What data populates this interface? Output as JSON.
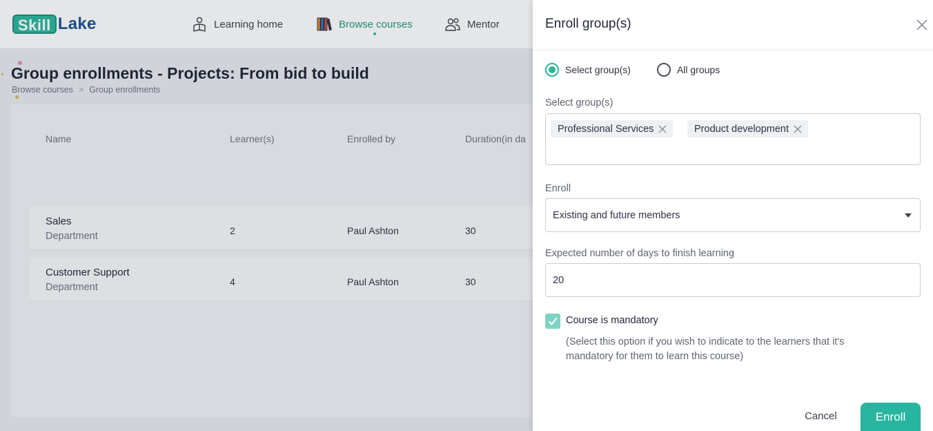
{
  "colors": {
    "accent": "#2bb59a",
    "enroll_button": "#28b5a0",
    "checkbox_checked": "#7fd3c2"
  },
  "header": {
    "logo_skill": "Skill",
    "logo_lake": "Lake",
    "nav": [
      {
        "label": "Learning home",
        "icon": "learner-icon"
      },
      {
        "label": "Browse courses",
        "icon": "books-icon",
        "active": true
      },
      {
        "label": "Mentor",
        "icon": "people-icon"
      }
    ]
  },
  "page": {
    "title": "Group enrollments - Projects: From bid to build",
    "breadcrumb": [
      "Browse courses",
      "Group enrollments"
    ],
    "breadcrumb_separator": ">",
    "table": {
      "columns": [
        "Name",
        "Learner(s)",
        "Enrolled by",
        "Duration(in da"
      ],
      "rows": [
        {
          "name": "Sales",
          "type": "Department",
          "learners": "2",
          "enrolled_by": "Paul Ashton",
          "duration": "30"
        },
        {
          "name": "Customer Support",
          "type": "Department",
          "learners": "4",
          "enrolled_by": "Paul Ashton",
          "duration": "30"
        }
      ]
    }
  },
  "panel": {
    "title": "Enroll group(s)",
    "radio_select": "Select group(s)",
    "radio_all": "All groups",
    "selected_radio": "Select group(s)",
    "groups_label": "Select group(s)",
    "chips": [
      "Professional Services",
      "Product development"
    ],
    "enroll_label": "Enroll",
    "enroll_value": "Existing and future members",
    "days_label": "Expected number of days to finish learning",
    "days_value": "20",
    "mandatory_checked": true,
    "mandatory_label": "Course is mandatory",
    "mandatory_help": "(Select this option if you wish to indicate to the learners that it's mandatory for them to learn this course)",
    "cancel_label": "Cancel",
    "submit_label": "Enroll"
  }
}
